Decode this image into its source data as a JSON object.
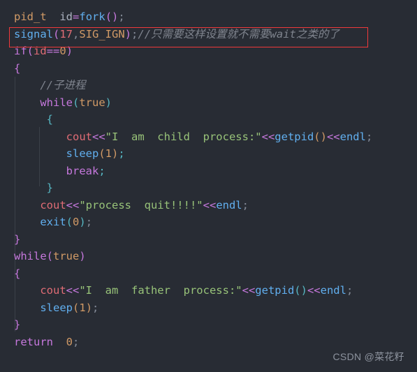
{
  "editor": {
    "background_color": "#282c34",
    "font_size_px": 15.5,
    "language": "C++"
  },
  "theme": {
    "type_color": "#d19a66",
    "variable_color": "#abb2bf",
    "operator_color": "#c678dd",
    "function_color": "#61afef",
    "punctuation_color": "#848b98",
    "number_color": "#d19a66",
    "keyword_color": "#c678dd",
    "identifier_color": "#e06c75",
    "string_color": "#98c379",
    "comment_color": "#7f848e",
    "cyan_color": "#56b6c2",
    "highlight_box_color": "#f0393b",
    "indent_guide_color": "#3b4048",
    "watermark_color": "#8d939e"
  },
  "code": {
    "lines": [
      {
        "n": 1,
        "text": "pid_t  id=fork();",
        "tokens": [
          {
            "t": "pid_t",
            "c": "t-type"
          },
          {
            "t": "  ",
            "c": "t-var"
          },
          {
            "t": "id",
            "c": "t-var"
          },
          {
            "t": "=",
            "c": "t-op"
          },
          {
            "t": "fork",
            "c": "t-fn"
          },
          {
            "t": "()",
            "c": "t-op"
          },
          {
            "t": ";",
            "c": "t-semi"
          }
        ]
      },
      {
        "n": 2,
        "text": "signal(17,SIG_IGN);//只需要这样设置就不需要wait之类的了",
        "tokens": [
          {
            "t": "signal",
            "c": "t-fn"
          },
          {
            "t": "(",
            "c": "t-op"
          },
          {
            "t": "17",
            "c": "t-numred"
          },
          {
            "t": ",",
            "c": "t-semi"
          },
          {
            "t": "SIG_IGN",
            "c": "t-type"
          },
          {
            "t": ")",
            "c": "t-op"
          },
          {
            "t": ";",
            "c": "t-semi"
          },
          {
            "t": "//只需要这样设置就不需要wait之类的了",
            "c": "t-comment"
          }
        ]
      },
      {
        "n": 3,
        "text": "if(id==0)",
        "tokens": [
          {
            "t": "if",
            "c": "t-kw"
          },
          {
            "t": "(",
            "c": "t-op"
          },
          {
            "t": "id",
            "c": "t-id"
          },
          {
            "t": "==",
            "c": "t-op"
          },
          {
            "t": "0",
            "c": "t-num"
          },
          {
            "t": ")",
            "c": "t-op"
          }
        ]
      },
      {
        "n": 4,
        "text": "{",
        "tokens": [
          {
            "t": "{",
            "c": "t-brace"
          }
        ]
      },
      {
        "n": 5,
        "text": "    //子进程",
        "tokens": [
          {
            "t": "    ",
            "c": "t-var"
          },
          {
            "t": "//子进程",
            "c": "t-comment"
          }
        ]
      },
      {
        "n": 6,
        "text": "    while(true)",
        "tokens": [
          {
            "t": "    ",
            "c": "t-var"
          },
          {
            "t": "while",
            "c": "t-kw"
          },
          {
            "t": "(",
            "c": "t-paren-c"
          },
          {
            "t": "true",
            "c": "t-num"
          },
          {
            "t": ")",
            "c": "t-paren-c"
          }
        ]
      },
      {
        "n": 7,
        "text": "     {",
        "tokens": [
          {
            "t": "     ",
            "c": "t-var"
          },
          {
            "t": "{",
            "c": "t-brace2"
          }
        ]
      },
      {
        "n": 8,
        "text": "        cout<<\"I  am  child  process:\"<<getpid()<<endl;",
        "tokens": [
          {
            "t": "        ",
            "c": "t-var"
          },
          {
            "t": "cout",
            "c": "t-cout"
          },
          {
            "t": "<<",
            "c": "t-shift"
          },
          {
            "t": "\"I  am  child  process:\"",
            "c": "t-str"
          },
          {
            "t": "<<",
            "c": "t-shift"
          },
          {
            "t": "getpid",
            "c": "t-endl"
          },
          {
            "t": "()",
            "c": "t-paren-o"
          },
          {
            "t": "<<",
            "c": "t-shift"
          },
          {
            "t": "endl",
            "c": "t-endl"
          },
          {
            "t": ";",
            "c": "t-semi"
          }
        ]
      },
      {
        "n": 9,
        "text": "        sleep(1);",
        "tokens": [
          {
            "t": "        ",
            "c": "t-var"
          },
          {
            "t": "sleep",
            "c": "t-endl"
          },
          {
            "t": "(",
            "c": "t-paren-o"
          },
          {
            "t": "1",
            "c": "t-num"
          },
          {
            "t": ")",
            "c": "t-paren-o"
          },
          {
            "t": ";",
            "c": "t-semi-c"
          }
        ]
      },
      {
        "n": 10,
        "text": "        break;",
        "tokens": [
          {
            "t": "        ",
            "c": "t-var"
          },
          {
            "t": "break",
            "c": "t-kw"
          },
          {
            "t": ";",
            "c": "t-semi-c"
          }
        ]
      },
      {
        "n": 11,
        "text": "     }",
        "tokens": [
          {
            "t": "     ",
            "c": "t-var"
          },
          {
            "t": "}",
            "c": "t-brace2"
          }
        ]
      },
      {
        "n": 12,
        "text": "    cout<<\"process  quit!!!!\"<<endl;",
        "tokens": [
          {
            "t": "    ",
            "c": "t-var"
          },
          {
            "t": "cout",
            "c": "t-cout"
          },
          {
            "t": "<<",
            "c": "t-shift"
          },
          {
            "t": "\"process  quit!!!!\"",
            "c": "t-str"
          },
          {
            "t": "<<",
            "c": "t-shift"
          },
          {
            "t": "endl",
            "c": "t-endl"
          },
          {
            "t": ";",
            "c": "t-semi"
          }
        ]
      },
      {
        "n": 13,
        "text": "    exit(0);",
        "tokens": [
          {
            "t": "    ",
            "c": "t-var"
          },
          {
            "t": "exit",
            "c": "t-endl"
          },
          {
            "t": "(",
            "c": "t-paren-c"
          },
          {
            "t": "0",
            "c": "t-num"
          },
          {
            "t": ")",
            "c": "t-paren-c"
          },
          {
            "t": ";",
            "c": "t-semi"
          }
        ]
      },
      {
        "n": 14,
        "text": "}",
        "tokens": [
          {
            "t": "}",
            "c": "t-brace"
          }
        ]
      },
      {
        "n": 15,
        "text": "while(true)",
        "tokens": [
          {
            "t": "while",
            "c": "t-kw"
          },
          {
            "t": "(",
            "c": "t-op"
          },
          {
            "t": "true",
            "c": "t-num"
          },
          {
            "t": ")",
            "c": "t-op"
          }
        ]
      },
      {
        "n": 16,
        "text": "{",
        "tokens": [
          {
            "t": "{",
            "c": "t-brace"
          }
        ]
      },
      {
        "n": 17,
        "text": "    cout<<\"I  am  father  process:\"<<getpid()<<endl;",
        "tokens": [
          {
            "t": "    ",
            "c": "t-var"
          },
          {
            "t": "cout",
            "c": "t-cout"
          },
          {
            "t": "<<",
            "c": "t-shift"
          },
          {
            "t": "\"I  am  father  process:\"",
            "c": "t-str"
          },
          {
            "t": "<<",
            "c": "t-shift"
          },
          {
            "t": "getpid",
            "c": "t-endl"
          },
          {
            "t": "()",
            "c": "t-paren-c"
          },
          {
            "t": "<<",
            "c": "t-shift"
          },
          {
            "t": "endl",
            "c": "t-endl"
          },
          {
            "t": ";",
            "c": "t-semi"
          }
        ]
      },
      {
        "n": 18,
        "text": "    sleep(1);",
        "tokens": [
          {
            "t": "    ",
            "c": "t-var"
          },
          {
            "t": "sleep",
            "c": "t-endl"
          },
          {
            "t": "(",
            "c": "t-paren-o"
          },
          {
            "t": "1",
            "c": "t-num"
          },
          {
            "t": ")",
            "c": "t-paren-o"
          },
          {
            "t": ";",
            "c": "t-semi"
          }
        ]
      },
      {
        "n": 19,
        "text": "}",
        "tokens": [
          {
            "t": "}",
            "c": "t-brace"
          }
        ]
      },
      {
        "n": 20,
        "text": "return  0;",
        "tokens": [
          {
            "t": "return",
            "c": "t-kw"
          },
          {
            "t": "  ",
            "c": "t-var"
          },
          {
            "t": "0",
            "c": "t-num"
          },
          {
            "t": ";",
            "c": "t-semi"
          }
        ]
      }
    ]
  },
  "annotation": {
    "highlight_line_number": 2,
    "highlight_label": "signal(17,SIG_IGN) line highlighted with red rectangle"
  },
  "watermark": {
    "text": "CSDN @菜花籽"
  }
}
